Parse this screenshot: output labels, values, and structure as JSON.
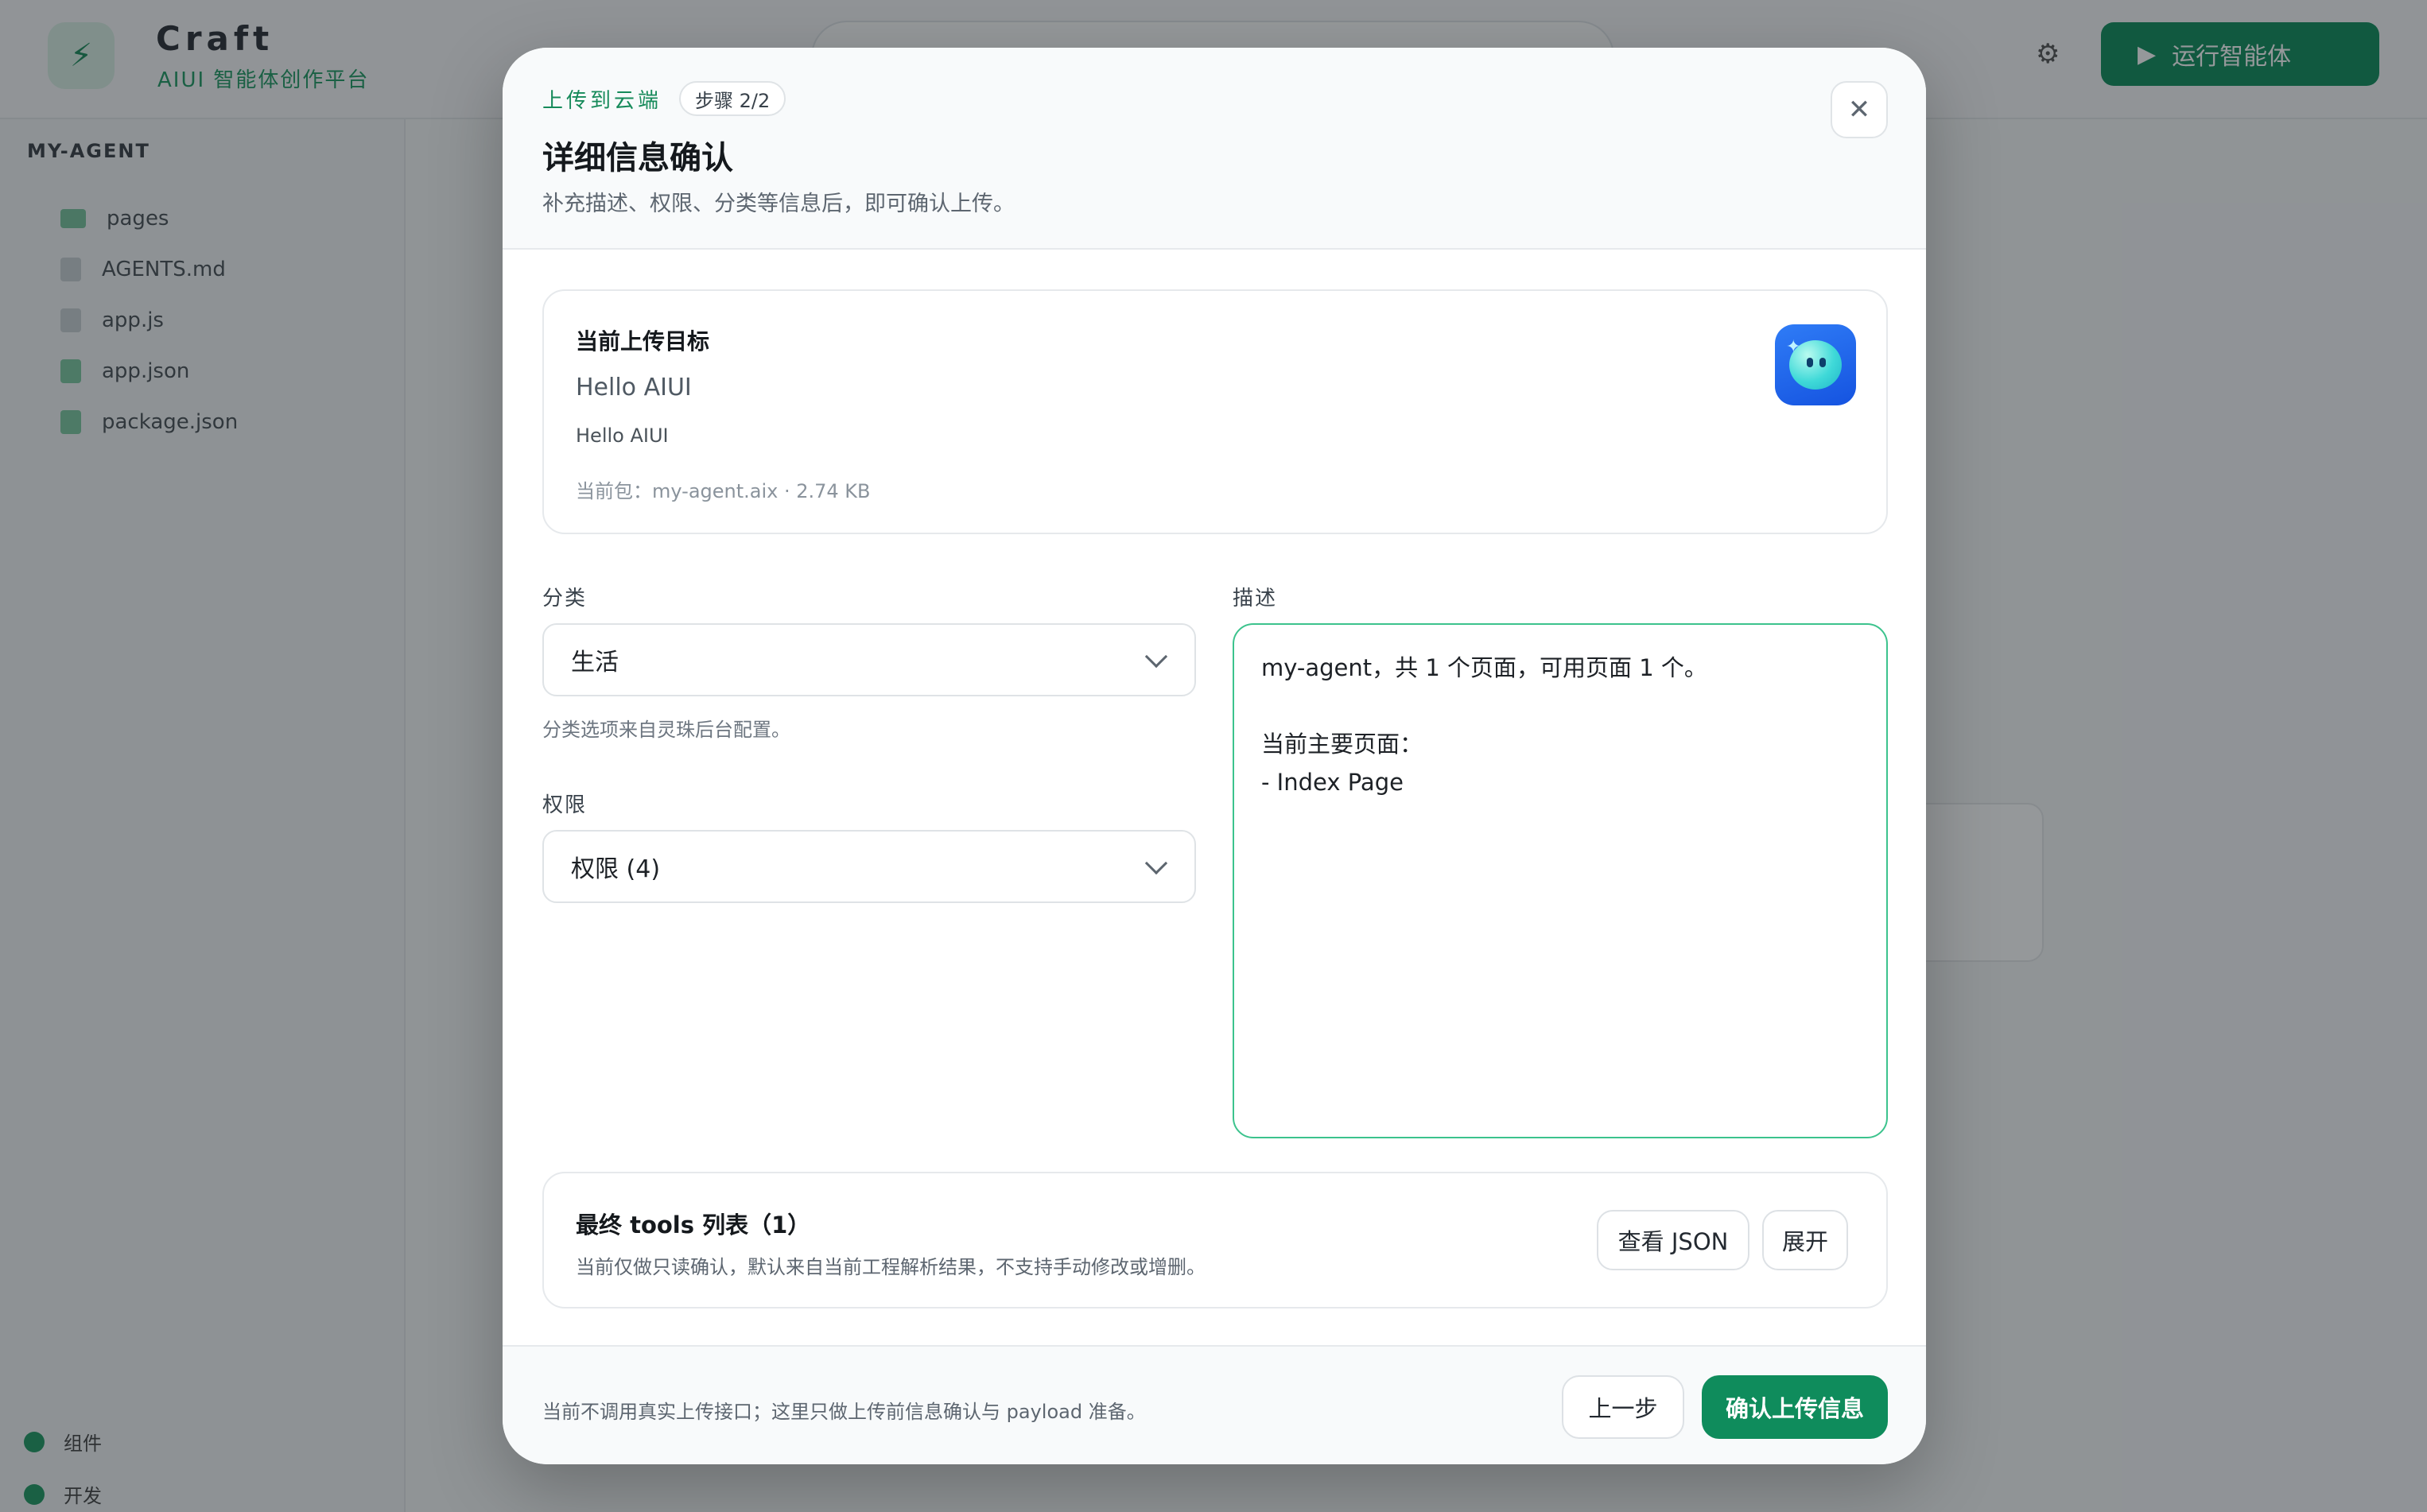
{
  "background": {
    "brand": "Craft",
    "brand_subtitle": "AIUI 智能体创作平台",
    "run_button": "运行智能体",
    "project_name": "MY-AGENT",
    "files": [
      "pages",
      "AGENTS.md",
      "app.js",
      "app.json",
      "package.json"
    ],
    "sidebar_footer": [
      "组件",
      "开发"
    ]
  },
  "modal": {
    "kicker": "上传到云端",
    "step_badge": "步骤 2/2",
    "title": "详细信息确认",
    "subtitle": "补充描述、权限、分类等信息后，即可确认上传。",
    "close_icon": "close-icon",
    "target": {
      "label": "当前上传目标",
      "name": "Hello AIUI",
      "description": "Hello AIUI",
      "package": "当前包：my-agent.aix · 2.74 KB",
      "icon": "app-bubble-icon"
    },
    "category": {
      "label": "分类",
      "value": "生活",
      "hint": "分类选项来自灵珠后台配置。"
    },
    "permission": {
      "label": "权限",
      "value": "权限 (4)"
    },
    "description": {
      "label": "描述",
      "value": "my-agent，共 1 个页面，可用页面 1 个。\n\n当前主要页面：\n- Index Page"
    },
    "tools": {
      "title": "最终 tools 列表（1）",
      "note": "当前仅做只读确认，默认来自当前工程解析结果，不支持手动修改或增删。",
      "view_json": "查看 JSON",
      "expand": "展开"
    },
    "footer": {
      "note": "当前不调用真实上传接口；这里只做上传前信息确认与 payload 准备。",
      "back": "上一步",
      "confirm": "确认上传信息"
    }
  },
  "colors": {
    "accent": "#0f8c5c",
    "focus_border": "#3cc38d",
    "overlay": "rgba(20,26,32,0.45)"
  }
}
